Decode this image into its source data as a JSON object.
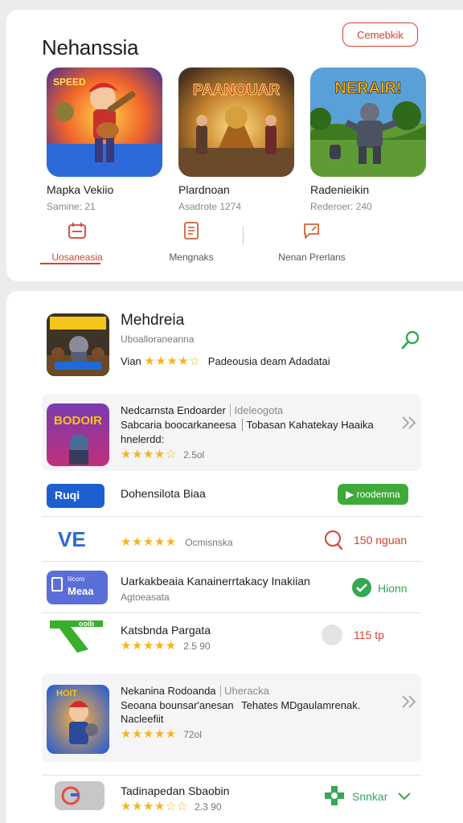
{
  "header": {
    "title": "Nehanssia",
    "action_label": "Cemebkik"
  },
  "featured": [
    {
      "name": "Mapka Vekiio",
      "sub": "Samine: 21",
      "art_title": "SPEED"
    },
    {
      "name": "Plardnoan",
      "sub": "Asadrote 1274",
      "art_title": "PAANOUAR"
    },
    {
      "name": "Radenieikin",
      "sub": "Rederoer: 240",
      "art_title": "NERAIR!"
    }
  ],
  "tabs": [
    {
      "label": "Uosaneasia",
      "icon": "calendar-icon",
      "active": true
    },
    {
      "label": "Mengnaks",
      "icon": "document-icon",
      "active": false
    },
    {
      "label": "Nenan Prerlans",
      "icon": "chat-edit-icon",
      "active": false
    }
  ],
  "list": {
    "top_item": {
      "title": "Mehdreia",
      "subtitle": "Uboalloraneanna",
      "prefix": "Vian",
      "stars": "★★★★☆",
      "rating_note": "Padeousia deam Adadatai",
      "icon": "leaf-search-icon"
    },
    "item_1": {
      "title": "Nedcarnsta Endoarder",
      "tag": "Ideleogota",
      "desc_1": "Sabcaria boocarkaneesa",
      "desc_2": "Tobasan Kahatekay Haaika",
      "desc_3": "hnelerdd:",
      "stars": "★★★★☆",
      "rating": "2.5ol",
      "art_title": "BODOIR"
    },
    "item_2": {
      "title": "Dohensilota Biaa",
      "button": "roodemna",
      "logo": "Ruqi"
    },
    "item_3": {
      "stars": "★★★★★",
      "label": "Ocmisnska",
      "price": "150 nguan",
      "logo": "VE"
    },
    "item_4": {
      "title": "Uarkakbeaia Kanainerrtakacy Inakiian",
      "subtitle": "Agtoeasata",
      "button": "Hionn",
      "logo_top": "Iiicoro",
      "logo_bottom": "Meaa"
    },
    "item_5": {
      "title": "Katsbnda Pargata",
      "stars": "★★★★★",
      "rating": "2.5 90",
      "price": "115 tp",
      "logo": "ooib"
    },
    "item_6": {
      "title": "Nekanina Rodoanda",
      "tag": "Uheracka",
      "desc_1": "Seoana bounsar'anesan",
      "desc_2": "Tehates MDgaulamrenak.",
      "desc_3": "Nacleefiit",
      "stars": "★★★★★",
      "rating": "72ol",
      "art_title": "HOIT"
    },
    "item_7": {
      "title": "Tadinapedan Sbaobin",
      "stars": "★★★★☆☆",
      "rating": "2.3 90",
      "button": "Snnkar"
    }
  },
  "colors": {
    "accent_red": "#d93f2e",
    "accent_green": "#34a853",
    "star": "#f5b51b"
  }
}
